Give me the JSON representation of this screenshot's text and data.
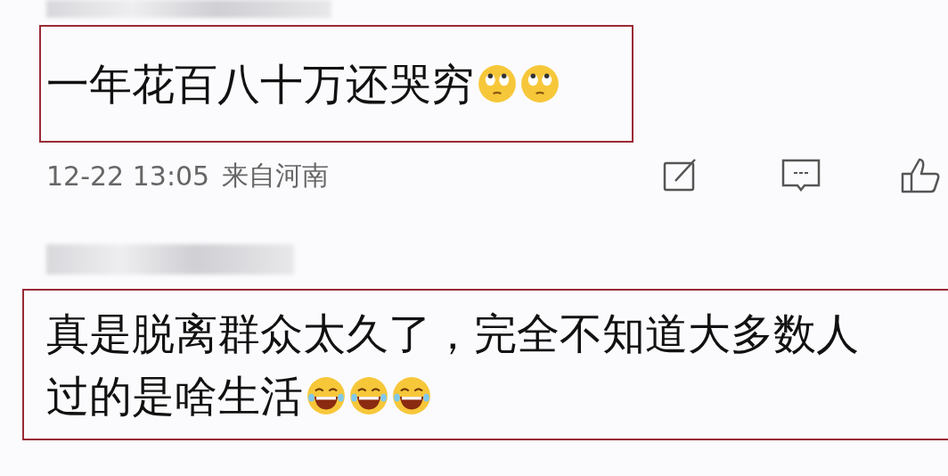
{
  "comments": [
    {
      "author_blurred": true,
      "highlighted": true,
      "lines": [
        "一年花百八十万还哭穷"
      ],
      "emojis": [
        {
          "kind": "eye-roll"
        },
        {
          "kind": "eye-roll"
        }
      ],
      "time": "12-22 13:05",
      "location": "来自河南",
      "actions": [
        {
          "kind": "edit"
        },
        {
          "kind": "reply"
        },
        {
          "kind": "like"
        }
      ]
    },
    {
      "author_blurred": true,
      "highlighted": true,
      "lines": [
        "真是脱离群众太久了，完全不知道大多数人",
        "过的是啥生活"
      ],
      "emojis": [
        {
          "kind": "laugh"
        },
        {
          "kind": "laugh"
        },
        {
          "kind": "laugh"
        }
      ]
    }
  ]
}
